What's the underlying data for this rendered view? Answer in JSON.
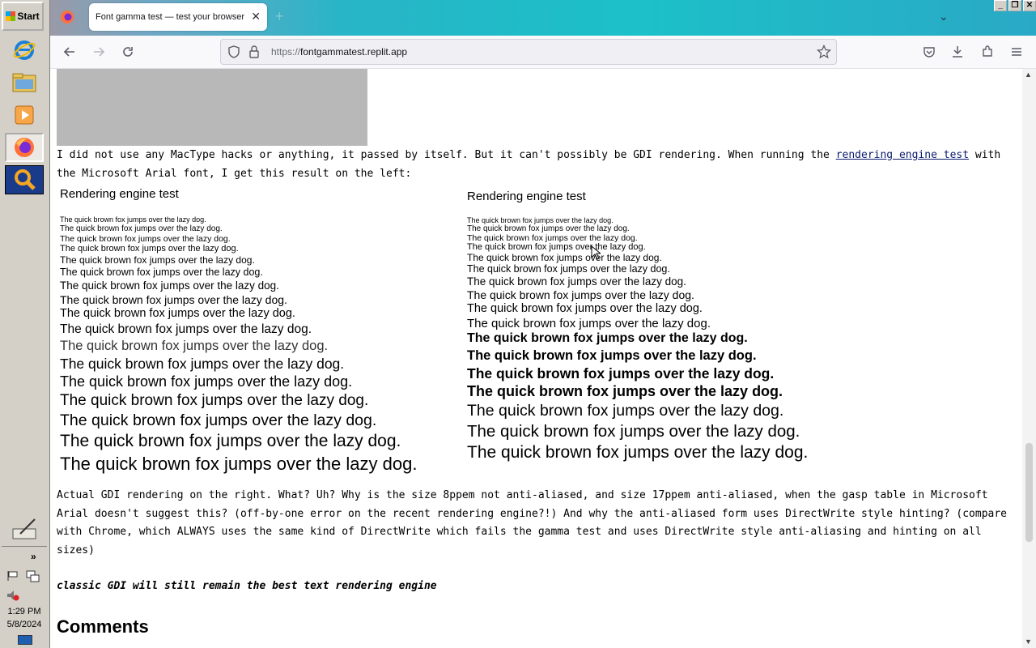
{
  "taskbar": {
    "start_label": "Start",
    "clock_time": "1:29 PM",
    "clock_date": "5/8/2024",
    "apps": [
      "internet-explorer",
      "file-explorer",
      "media-player",
      "firefox",
      "search"
    ]
  },
  "browser": {
    "tab_title": "Font gamma test — test your browser",
    "url_prefix": "https://",
    "url_domain": "fontgammatest.replit.app"
  },
  "content": {
    "para1_before_link": "I did not use any MacType hacks or anything, it passed by itself. But it can't possibly be GDI rendering. When running the ",
    "para1_link": "rendering engine test",
    "para1_after_link": " with the Microsoft Arial font, I get this result on the left:",
    "left_title": "Rendering engine test",
    "right_title": "Rendering engine test",
    "sample": "The quick brown fox jumps over the lazy dog.",
    "para2": "Actual GDI rendering on the right. What? Uh? Why is the size 8ppem not anti-aliased, and size 17ppem anti-aliased, when the gasp table in Microsoft Arial doesn't suggest this? (off-by-one error on the recent rendering engine?!) And why the anti-aliased form uses DirectWrite style hinting? (compare with Chrome, which ALWAYS uses the same kind of DirectWrite which fails the gamma test and uses DirectWrite style anti-aliasing and hinting on all sizes)",
    "quote": "classic GDI will still remain the best text rendering engine",
    "comments_heading": "Comments"
  }
}
